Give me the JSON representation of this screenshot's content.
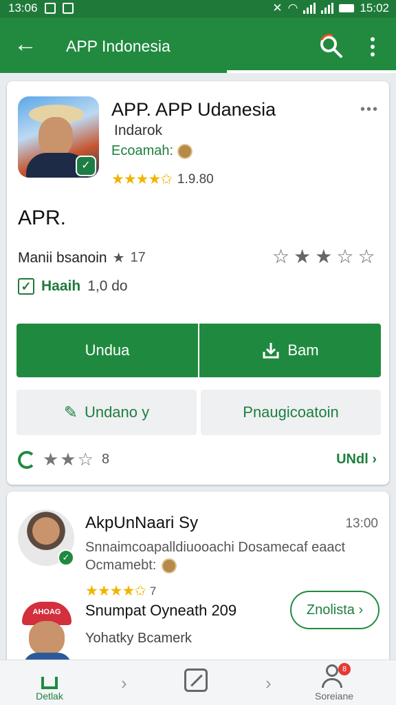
{
  "status_bar": {
    "time_left": "13:06",
    "time_right": "15:02"
  },
  "app_bar": {
    "title": "APP Indonesia"
  },
  "app": {
    "name": "APP. APP Udanesia",
    "developer": "Indarok",
    "category": "Ecoamah:",
    "stars": "★★★★✩",
    "rating_count": "1.9.80",
    "more": "•••"
  },
  "details": {
    "big_label": "APR.",
    "review_summary": "Manii bsanoin",
    "review_star": "★",
    "review_count": "17",
    "rate_stars": [
      "☆",
      "★",
      "★",
      "☆",
      "☆"
    ],
    "check_label": "Haaih",
    "check_value": "1,0 do"
  },
  "buttons": {
    "primary": "Undua",
    "secondary": "Bam",
    "tertiary_left": "Undano y",
    "tertiary_right": "Pnaugicoatoin"
  },
  "card_footer": {
    "stars": "★★☆",
    "count": "8",
    "more_link": "UNdl ›"
  },
  "review": {
    "name": "AkpUnNaari Sy",
    "time": "13:00",
    "text": "Snnaimcoapalldiuooachi Dosamecaf eaact",
    "sub": "Ocmamebt:",
    "stars": "★★★★✩",
    "star_count": "7",
    "title": "Snumpat Oyneath 209",
    "developer": "Yohatky Bcamerk",
    "cap_text": "AHOAG",
    "action": "Znolista ›"
  },
  "bottom_nav": {
    "home_label": "Detlak",
    "account_label": "Soreiane",
    "badge": "8"
  },
  "colors": {
    "primary": "#218a3f",
    "accent": "#1d7f3e",
    "star": "#f0b400"
  }
}
